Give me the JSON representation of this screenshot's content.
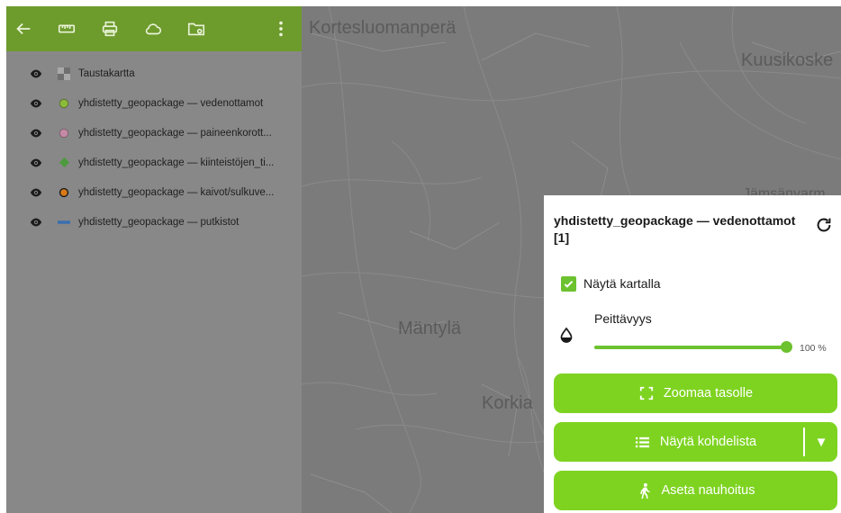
{
  "toolbar": {
    "icons": [
      "back-arrow-icon",
      "ruler-icon",
      "print-icon",
      "cloud-icon",
      "folder-settings-icon",
      "more-vertical-icon"
    ]
  },
  "layers": [
    {
      "label": "Taustakartta",
      "symbol": "basemap-icon",
      "visible": true
    },
    {
      "label": "yhdistetty_geopackage — vedenottamot",
      "symbol": "green-circle",
      "color": "#8bbb3a",
      "visible": true
    },
    {
      "label": "yhdistetty_geopackage — paineenkorott...",
      "symbol": "pink-circle",
      "color": "#c48aa5",
      "visible": true
    },
    {
      "label": "yhdistetty_geopackage — kiinteistöjen_ti...",
      "symbol": "green-diamond",
      "color": "#4e9a3f",
      "visible": true
    },
    {
      "label": "yhdistetty_geopackage — kaivot/sulkuve...",
      "symbol": "orange-circle",
      "color": "#d97a17",
      "visible": true
    },
    {
      "label": "yhdistetty_geopackage — putkistot",
      "symbol": "blue-line",
      "color": "#3b6fb0",
      "visible": true
    }
  ],
  "map": {
    "places": [
      "Kortesluomanperä",
      "Kuusikoske",
      "Mäntylä",
      "Korkia",
      "Jämsänvarm"
    ]
  },
  "properties": {
    "title": "yhdistetty_geopackage — vedenottamot [1]",
    "refresh_icon": "refresh-icon",
    "show_on_map_label": "Näytä kartalla",
    "show_on_map_checked": true,
    "opacity_label": "Peittävyys",
    "opacity_value": "100 %",
    "opacity_fraction": 1.0,
    "zoom_button": "Zoomaa tasolle",
    "feature_list_button": "Näytä kohdelista",
    "recording_button": "Aseta nauhoitus",
    "accent": "#7ed321"
  }
}
